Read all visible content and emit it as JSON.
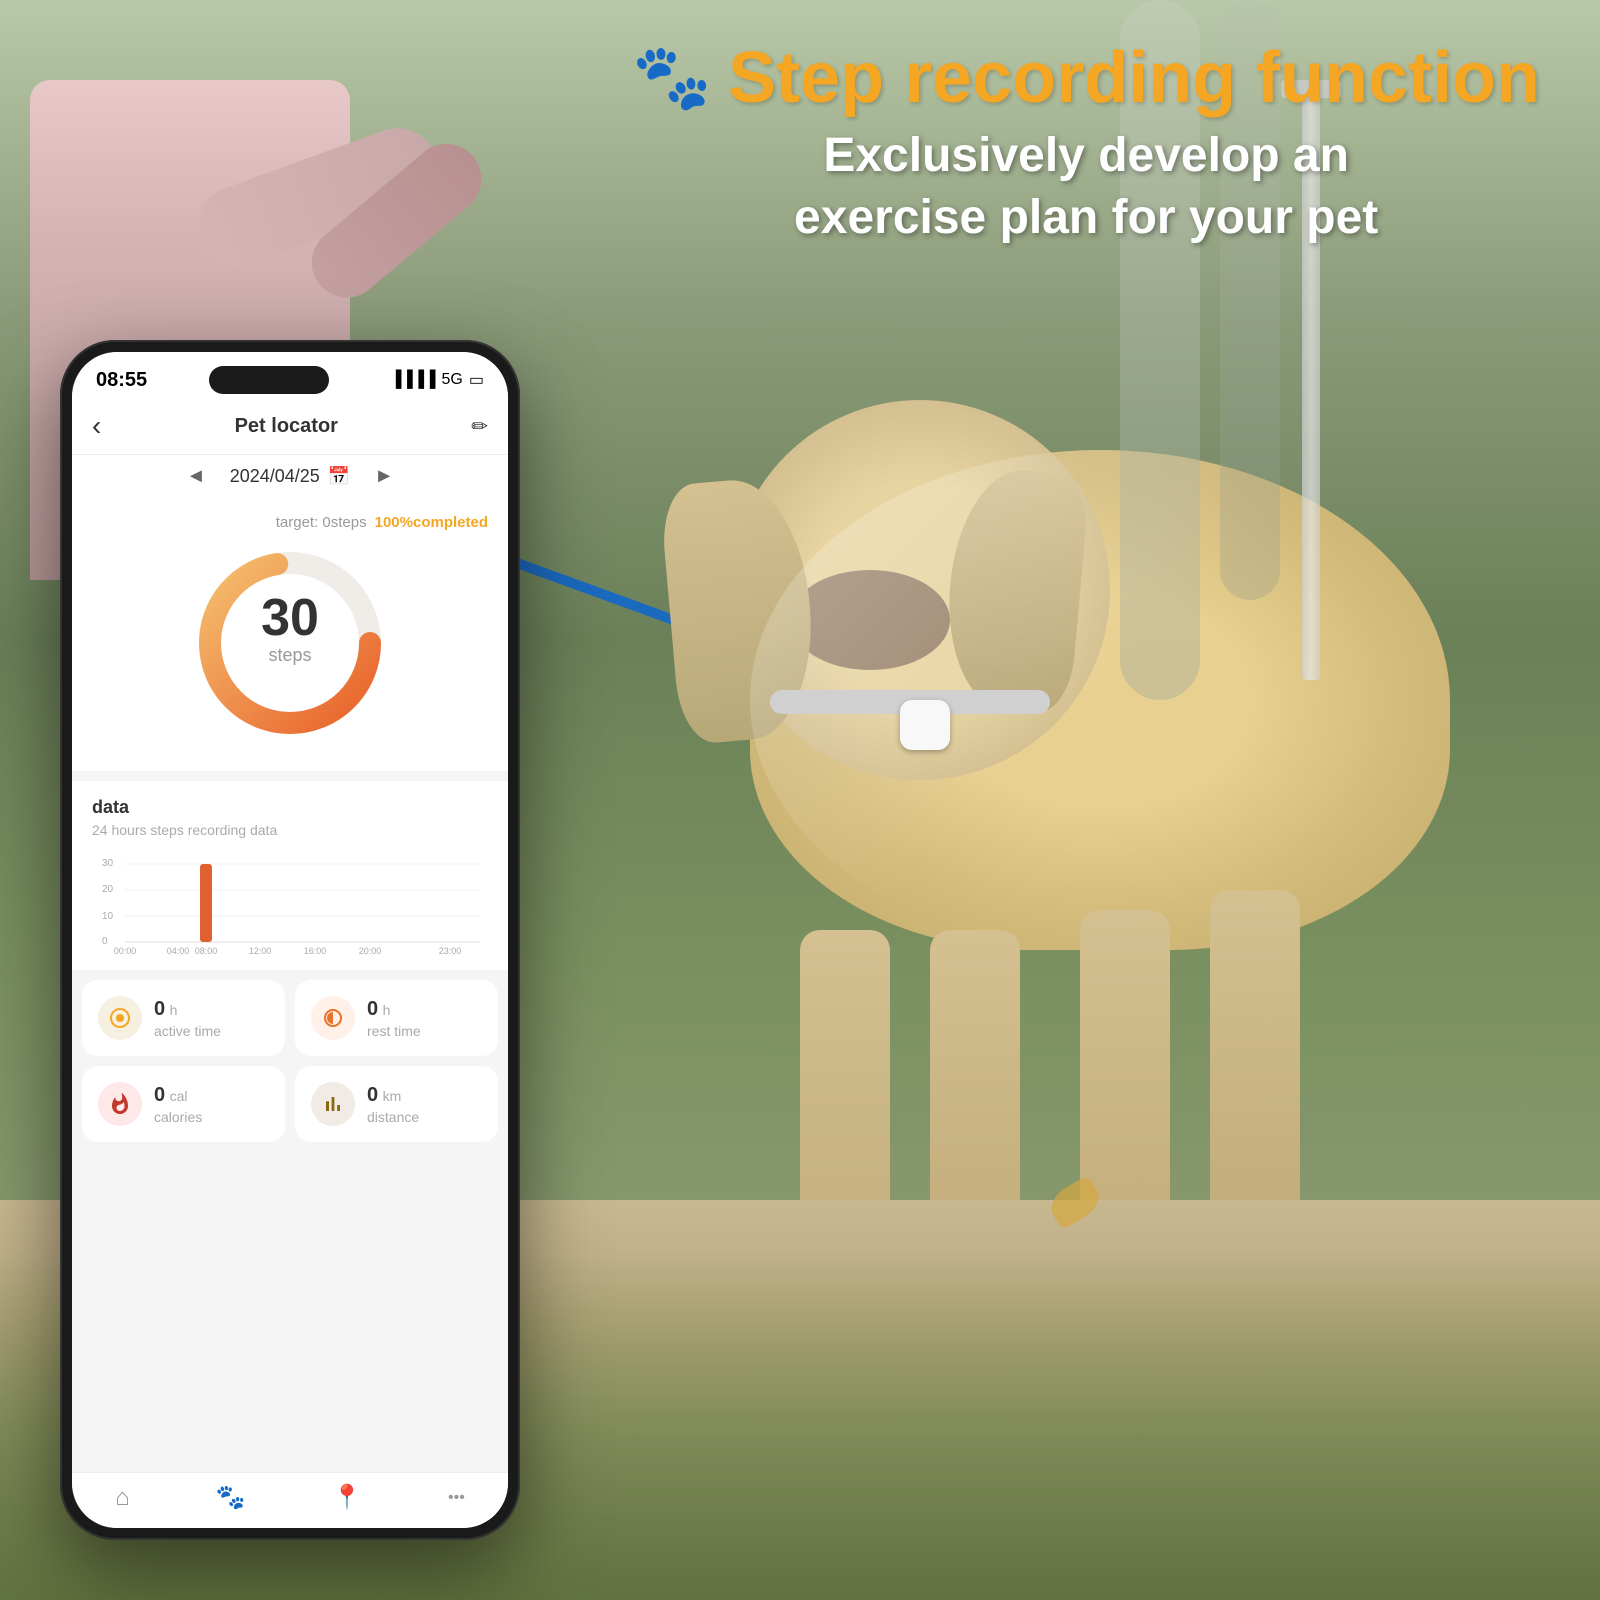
{
  "header": {
    "paw_icon": "🐾",
    "title": "Step recording function",
    "subtitle_line1": "Exclusively develop an",
    "subtitle_line2": "exercise plan for your pet"
  },
  "phone": {
    "status": {
      "time": "08:55",
      "signal": "📶",
      "network": "5G",
      "battery": "🔋"
    },
    "nav": {
      "back_icon": "‹",
      "title": "Pet locator",
      "edit_icon": "✎"
    },
    "date": {
      "prev_icon": "◄",
      "value": "2024/04/25",
      "calendar_icon": "📅",
      "next_icon": "►"
    },
    "steps": {
      "target_label": "target: 0steps",
      "completed_label": "100%completed",
      "count": "30",
      "unit": "steps"
    },
    "chart": {
      "title": "data",
      "subtitle": "24 hours steps recording data",
      "y_labels": [
        "30",
        "20",
        "10",
        "0"
      ],
      "x_labels": [
        "00:00",
        "04:00",
        "08:00",
        "12:00",
        "16:00",
        "20:00",
        "23:00"
      ]
    },
    "stats": [
      {
        "icon": "〜",
        "icon_type": "yellow",
        "value": "0",
        "unit": "h",
        "name": "active time"
      },
      {
        "icon": "☽",
        "icon_type": "orange",
        "value": "0",
        "unit": "h",
        "name": "rest time"
      },
      {
        "icon": "🔥",
        "icon_type": "red",
        "value": "0",
        "unit": "cal",
        "name": "calories"
      },
      {
        "icon": "📊",
        "icon_type": "brown",
        "value": "0",
        "unit": "km",
        "name": "distance"
      }
    ],
    "tabs": [
      {
        "icon": "⌂",
        "label": "",
        "active": false
      },
      {
        "icon": "🐾",
        "label": "",
        "active": true
      },
      {
        "icon": "📍",
        "label": "",
        "active": false
      },
      {
        "icon": "•••",
        "label": "",
        "active": false
      }
    ]
  },
  "colors": {
    "orange_accent": "#f5a623",
    "white": "#ffffff",
    "text_dark": "#333333",
    "text_gray": "#999999"
  }
}
